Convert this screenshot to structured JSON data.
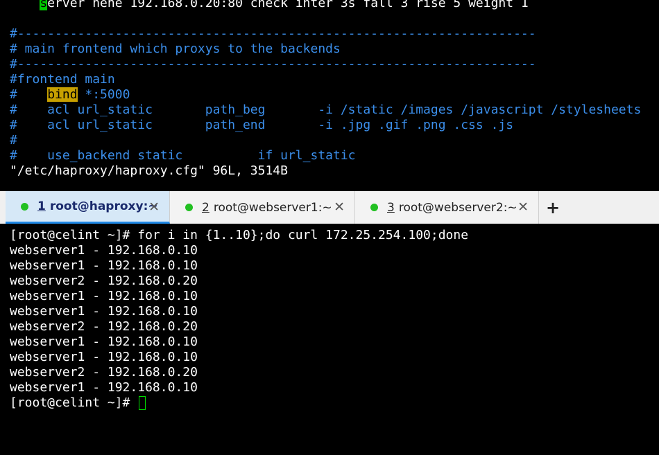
{
  "editor": {
    "lines": [
      {
        "first_char": "s",
        "rest": "erver hehe 192.168.0.20:80 check inter 3s fall 3 rise 5 weight 1"
      },
      {
        "text": ""
      },
      {
        "text": "#---------------------------------------------------------------------"
      },
      {
        "text": "# main frontend which proxys to the backends"
      },
      {
        "text": "#---------------------------------------------------------------------"
      },
      {
        "text": "#frontend main"
      },
      {
        "pre": "#    ",
        "highlight": "bind",
        "post": " *:5000"
      },
      {
        "text": "#    acl url_static       path_beg       -i /static /images /javascript /stylesheets"
      },
      {
        "text": "#    acl url_static       path_end       -i .jpg .gif .png .css .js"
      },
      {
        "text": "#"
      },
      {
        "text": "#    use_backend static          if url_static"
      }
    ],
    "status_line": "\"/etc/haproxy/haproxy.cfg\" 96L, 3514B"
  },
  "tabs": [
    {
      "num": "1",
      "label": " root@haproxy:~",
      "close": "✕"
    },
    {
      "num": "2",
      "label": " root@webserver1:~",
      "close": "✕"
    },
    {
      "num": "3",
      "label": " root@webserver2:~",
      "close": "✕"
    }
  ],
  "add_tab": "+",
  "terminal": {
    "command": "[root@celint ~]# for i in {1..10};do curl 172.25.254.100;done",
    "output": [
      "webserver1 - 192.168.0.10",
      "webserver1 - 192.168.0.10",
      "webserver2 - 192.168.0.20",
      "webserver1 - 192.168.0.10",
      "webserver1 - 192.168.0.10",
      "webserver2 - 192.168.0.20",
      "webserver1 - 192.168.0.10",
      "webserver1 - 192.168.0.10",
      "webserver2 - 192.168.0.20",
      "webserver1 - 192.168.0.10"
    ],
    "prompt": "[root@celint ~]# "
  },
  "colors": {
    "comment": "#3b8eea",
    "highlight": "#c7a000",
    "tab_active": "#d6e8f7",
    "status_dot": "#22c022"
  }
}
